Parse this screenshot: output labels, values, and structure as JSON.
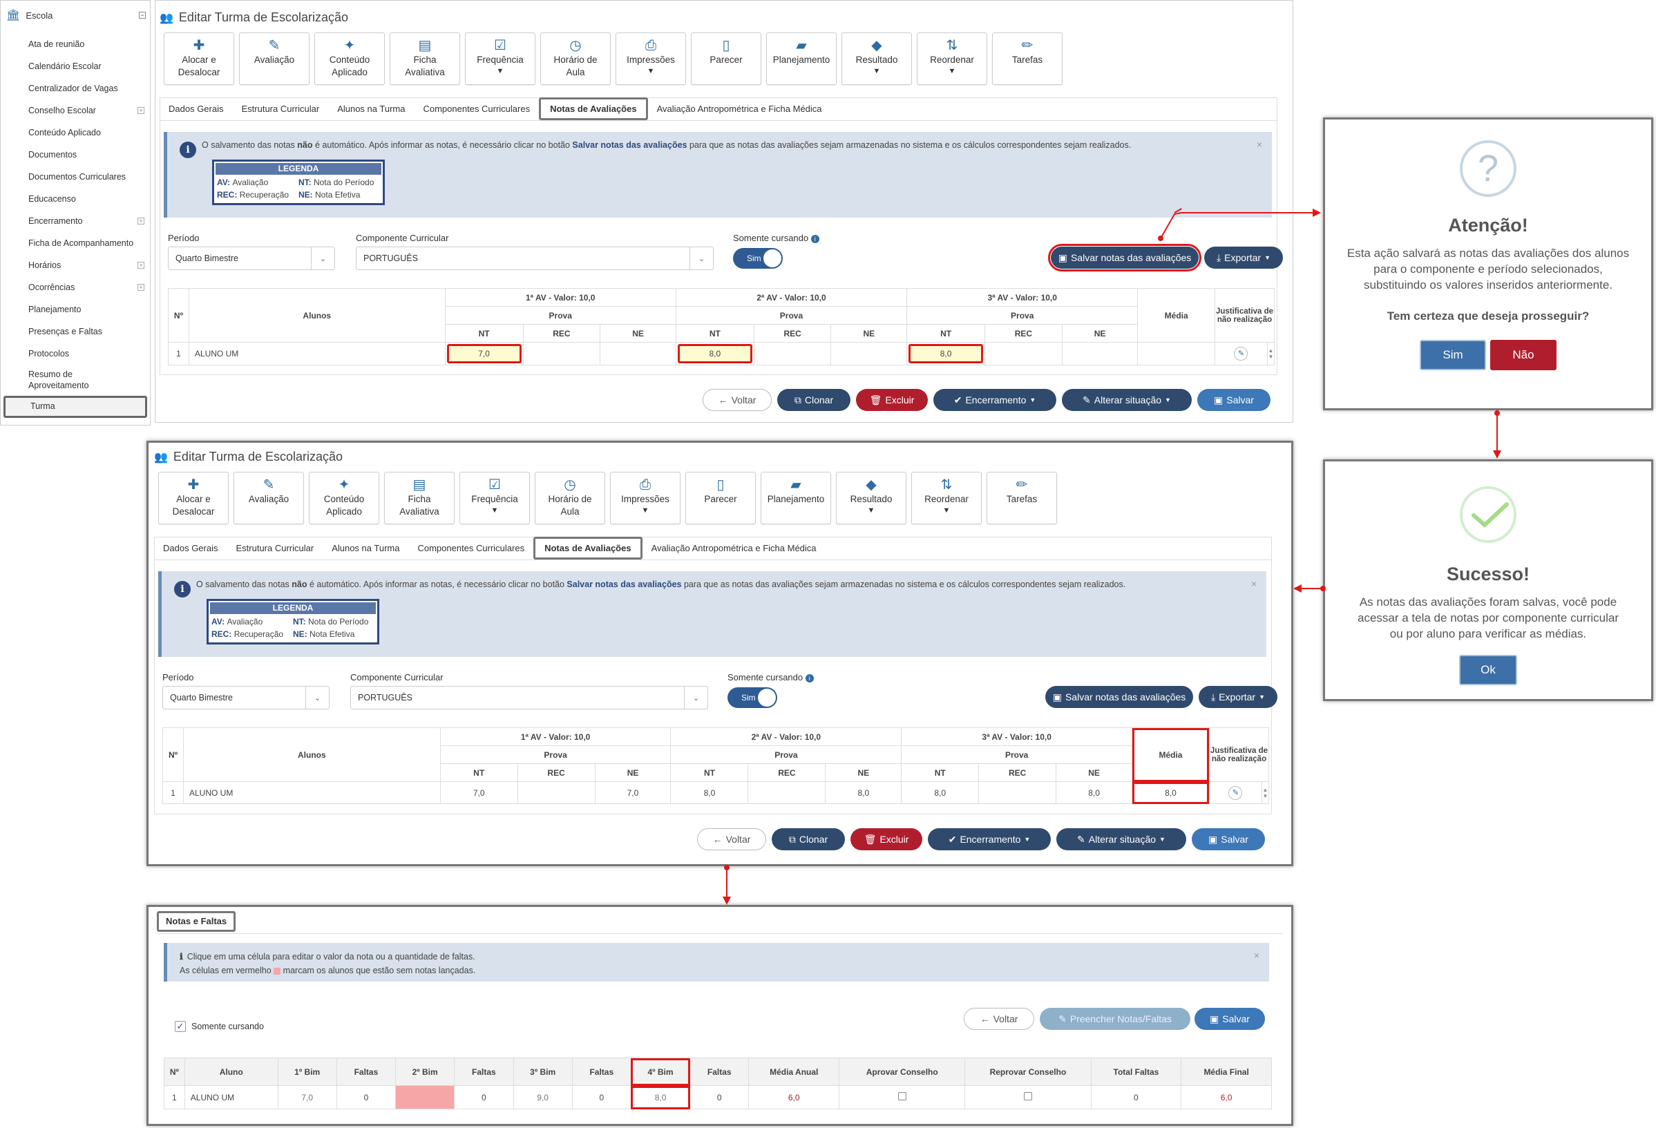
{
  "sidebar": {
    "title": "Escola",
    "items": [
      {
        "label": "Ata de reunião",
        "expandable": false
      },
      {
        "label": "Calendário Escolar",
        "expandable": false
      },
      {
        "label": "Centralizador de Vagas",
        "expandable": false
      },
      {
        "label": "Conselho Escolar",
        "expandable": true
      },
      {
        "label": "Conteúdo Aplicado",
        "expandable": false
      },
      {
        "label": "Documentos",
        "expandable": false
      },
      {
        "label": "Documentos Curriculares",
        "expandable": false
      },
      {
        "label": "Educacenso",
        "expandable": false
      },
      {
        "label": "Encerramento",
        "expandable": true
      },
      {
        "label": "Ficha de Acompanhamento",
        "expandable": false
      },
      {
        "label": "Horários",
        "expandable": true
      },
      {
        "label": "Ocorrências",
        "expandable": true
      },
      {
        "label": "Planejamento",
        "expandable": false
      },
      {
        "label": "Presenças e Faltas",
        "expandable": false
      },
      {
        "label": "Protocolos",
        "expandable": false
      },
      {
        "label": "Resumo de Aproveitamento",
        "expandable": false
      },
      {
        "label": "Turma",
        "expandable": false,
        "active": true
      }
    ]
  },
  "page": {
    "title": "Editar Turma de Escolarização",
    "toolbar": [
      {
        "l1": "Alocar e",
        "l2": "Desalocar",
        "icon": "puzzle-icon",
        "glyph": "✚"
      },
      {
        "l1": "Avaliação",
        "l2": "",
        "icon": "edit-icon",
        "glyph": "✎"
      },
      {
        "l1": "Conteúdo",
        "l2": "Aplicado",
        "icon": "magic-wand-icon",
        "glyph": "✦"
      },
      {
        "l1": "Ficha",
        "l2": "Avaliativa",
        "icon": "form-icon",
        "glyph": "▤"
      },
      {
        "l1": "Frequência",
        "l2": "",
        "icon": "check-square-icon",
        "glyph": "☑",
        "caret": true
      },
      {
        "l1": "Horário de",
        "l2": "Aula",
        "icon": "clock-icon",
        "glyph": "◷"
      },
      {
        "l1": "Impressões",
        "l2": "",
        "icon": "printer-icon",
        "glyph": "⎙",
        "caret": true
      },
      {
        "l1": "Parecer",
        "l2": "",
        "icon": "document-icon",
        "glyph": "▯"
      },
      {
        "l1": "Planejamento",
        "l2": "",
        "icon": "book-icon",
        "glyph": "▰"
      },
      {
        "l1": "Resultado",
        "l2": "",
        "icon": "graduation-cap-icon",
        "glyph": "◆",
        "caret": true
      },
      {
        "l1": "Reordenar",
        "l2": "",
        "icon": "sort-az-icon",
        "glyph": "⇅",
        "caret": true
      },
      {
        "l1": "Tarefas",
        "l2": "",
        "icon": "pencil-icon",
        "glyph": "✏"
      }
    ],
    "tabs": [
      "Dados Gerais",
      "Estrutura Curricular",
      "Alunos na Turma",
      "Componentes Curriculares",
      "Notas de Avaliações",
      "Avaliação Antropométrica e Ficha Médica"
    ],
    "active_tab": "Notas de Avaliações",
    "alert": {
      "part1": "O salvamento das notas ",
      "bold1": "não",
      "part2": " é automático. Após informar as notas, é necessário clicar no botão ",
      "bold2": "Salvar notas das avaliações",
      "part3": " para que as notas das avaliações sejam armazenadas no sistema e os cálculos correspondentes sejam realizados.",
      "close": "×"
    },
    "legend": {
      "title": "LEGENDA",
      "av_key": "AV:",
      "av_val": "Avaliação",
      "nt_key": "NT:",
      "nt_val": "Nota do Período",
      "rec_key": "REC:",
      "rec_val": "Recuperação",
      "ne_key": "NE:",
      "ne_val": "Nota Efetiva"
    },
    "filters": {
      "periodo_label": "Período",
      "periodo_value": "Quarto Bimestre",
      "componente_label": "Componente Curricular",
      "componente_value": "PORTUGUÊS",
      "cursando_label": "Somente cursando",
      "cursando_value": "Sim"
    },
    "buttons": {
      "salvar_notas": "Salvar notas das avaliações",
      "exportar": "Exportar",
      "voltar": "Voltar",
      "clonar": "Clonar",
      "excluir": "Excluir",
      "encerramento": "Encerramento",
      "alterar": "Alterar situação",
      "salvar": "Salvar"
    },
    "grid": {
      "n_header": "Nº",
      "alunos_header": "Alunos",
      "av_headers": [
        "1ª AV - Valor: 10,0",
        "2ª AV - Valor: 10,0",
        "3ª AV - Valor: 10,0"
      ],
      "prova": "Prova",
      "sub": [
        "NT",
        "REC",
        "NE"
      ],
      "media": "Média",
      "justificativa": "Justificativa de não realização",
      "row_n": "1",
      "row_name": "ALUNO UM"
    },
    "before": {
      "nt": [
        "7,0",
        "8,0",
        "8,0"
      ],
      "ne": [
        "",
        "",
        ""
      ],
      "media": ""
    },
    "after": {
      "nt": [
        "7,0",
        "8,0",
        "8,0"
      ],
      "ne": [
        "7,0",
        "8,0",
        "8,0"
      ],
      "media": "8,0"
    }
  },
  "confirm_dialog": {
    "icon": "?",
    "title": "Atenção!",
    "text": "Esta ação salvará as notas das avaliações dos alunos para o componente e período selecionados, substituindo os valores inseridos anteriormente.",
    "question": "Tem certeza que deseja prosseguir?",
    "yes": "Sim",
    "no": "Não"
  },
  "success_dialog": {
    "title": "Sucesso!",
    "text": "As notas das avaliações foram salvas, você pode acessar a tela de notas por componente curricular ou por aluno para verificar as médias.",
    "ok": "Ok"
  },
  "notas_faltas": {
    "tab": "Notas e Faltas",
    "info1": "Clique em uma célula para editar o valor da nota ou a quantidade de faltas.",
    "info2a": "As células em vermelho",
    "info2b": "marcam os alunos que estão sem notas lançadas.",
    "somente_cursando": "Somente cursando",
    "btn_voltar": "Voltar",
    "btn_preencher": "Preencher Notas/Faltas",
    "btn_salvar": "Salvar",
    "headers": [
      "Nº",
      "Aluno",
      "1º Bim",
      "Faltas",
      "2º Bim",
      "Faltas",
      "3º Bim",
      "Faltas",
      "4º Bim",
      "Faltas",
      "Média Anual",
      "Aprovar Conselho",
      "Reprovar Conselho",
      "Total Faltas",
      "Média Final"
    ],
    "row": [
      "1",
      "ALUNO UM",
      "7,0",
      "0",
      "",
      "0",
      "9,0",
      "0",
      "8,0",
      "0",
      "6,0",
      "",
      "",
      "0",
      "6,0"
    ],
    "colors": {
      "missing": "#f6a6a6",
      "red_value": "#b01e2e"
    }
  }
}
